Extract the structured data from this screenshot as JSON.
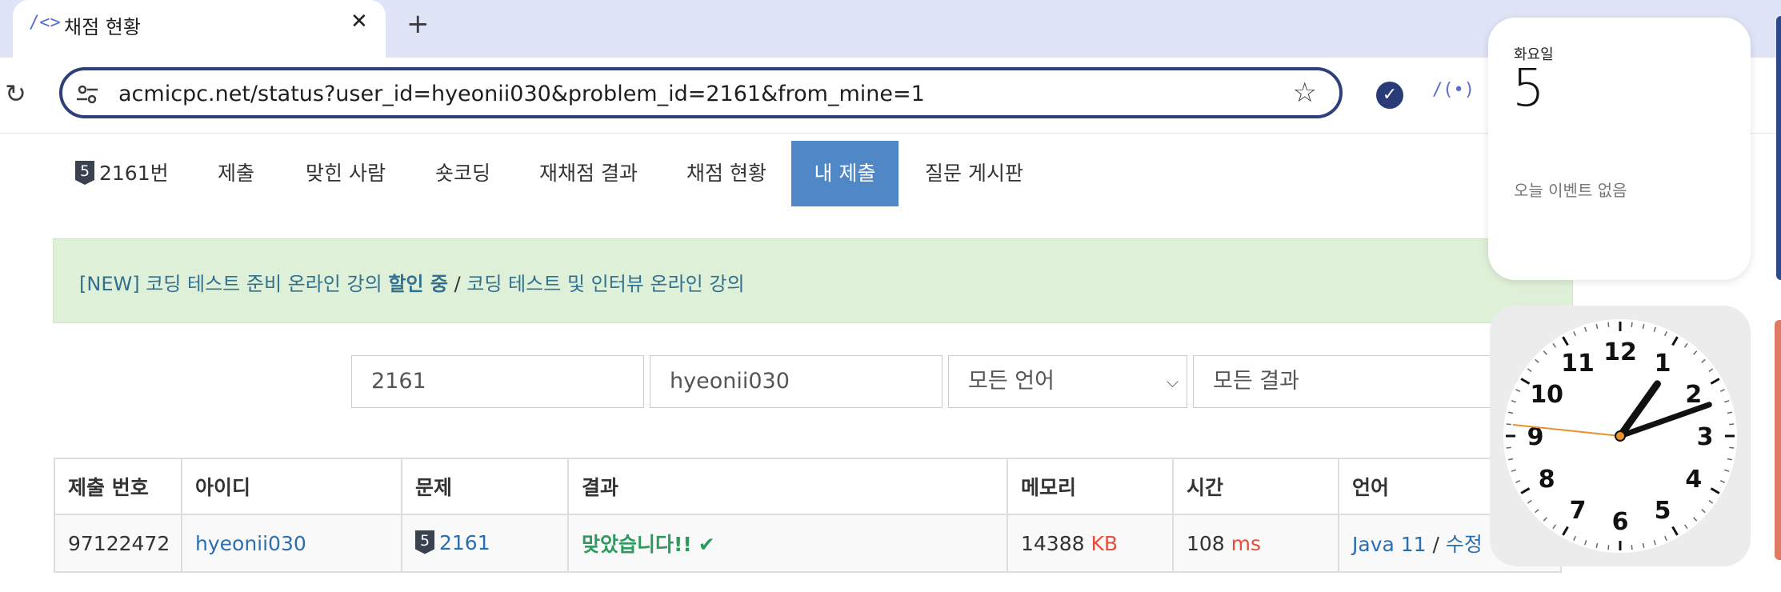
{
  "browser": {
    "tab_title": "채점 현황",
    "tab_favicon": "/<>",
    "new_tab_label": "+",
    "url": "acmicpc.net/status?user_id=hyeonii030&problem_id=2161&from_mine=1"
  },
  "nav": {
    "tier": "5",
    "items": [
      "2161번",
      "제출",
      "맞힌 사람",
      "숏코딩",
      "재채점 결과",
      "채점 현황",
      "내 제출",
      "질문 게시판"
    ],
    "active_index": 6
  },
  "banner": {
    "part1": "[NEW] 코딩 테스트 준비 온라인 강의",
    "part2": "할인 중",
    "separator": " / ",
    "part3": "코딩 테스트 및 인터뷰 온라인 강의"
  },
  "filters": {
    "problem_id": "2161",
    "user_id": "hyeonii030",
    "language": "모든 언어",
    "result": "모든 결과"
  },
  "table": {
    "headers": [
      "제출 번호",
      "아이디",
      "문제",
      "결과",
      "메모리",
      "시간",
      "언어"
    ],
    "rows": [
      {
        "submission_id": "97122472",
        "user": "hyeonii030",
        "tier": "5",
        "problem": "2161",
        "result": "맞았습니다!!",
        "memory": "14388",
        "memory_unit": "KB",
        "time": "108",
        "time_unit": "ms",
        "language": "Java 11",
        "lang_sep": " / ",
        "edit": "수정"
      }
    ]
  },
  "widgets": {
    "calendar": {
      "weekday": "화요일",
      "date": "5",
      "events": "오늘 이벤트 없음"
    },
    "clock": {
      "numbers": [
        "12",
        "1",
        "2",
        "3",
        "4",
        "5",
        "6",
        "7",
        "8",
        "9",
        "10",
        "11"
      ],
      "hour": 1,
      "minute": 11,
      "second": 46
    }
  },
  "colors": {
    "accent": "#4f87c7",
    "link": "#2a6fb0",
    "success": "#2f9a5f",
    "unit": "#e74c3c",
    "banner_bg": "#dff0d8"
  }
}
